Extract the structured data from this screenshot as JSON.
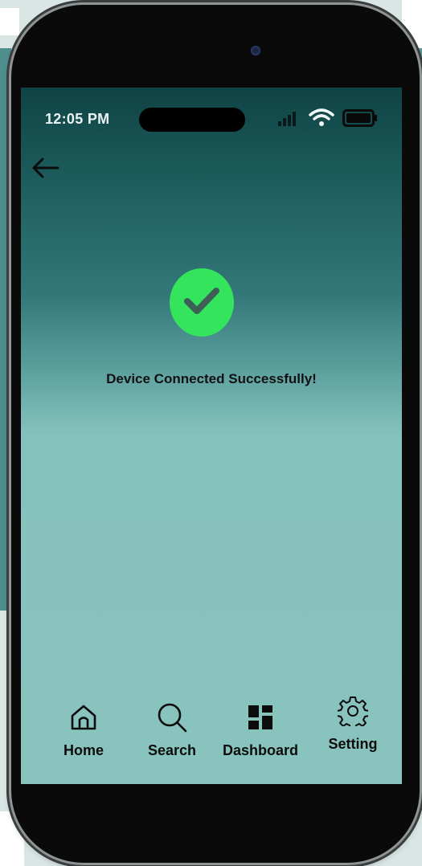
{
  "status_bar": {
    "time": "12:05 PM"
  },
  "back": {
    "icon": "arrow-left-icon"
  },
  "success": {
    "icon": "check-circle-icon",
    "badge_color": "#33e45c",
    "message": "Device Connected Successfully!"
  },
  "bottom_nav": {
    "items": [
      {
        "label": "Home",
        "icon": "home-icon"
      },
      {
        "label": "Search",
        "icon": "search-icon"
      },
      {
        "label": "Dashboard",
        "icon": "dashboard-icon"
      },
      {
        "label": "Setting",
        "icon": "gear-icon"
      }
    ]
  },
  "colors": {
    "gradient_top": "#0f4344",
    "gradient_bottom": "#89c3be",
    "phone_frame": "#0a0a0a"
  }
}
